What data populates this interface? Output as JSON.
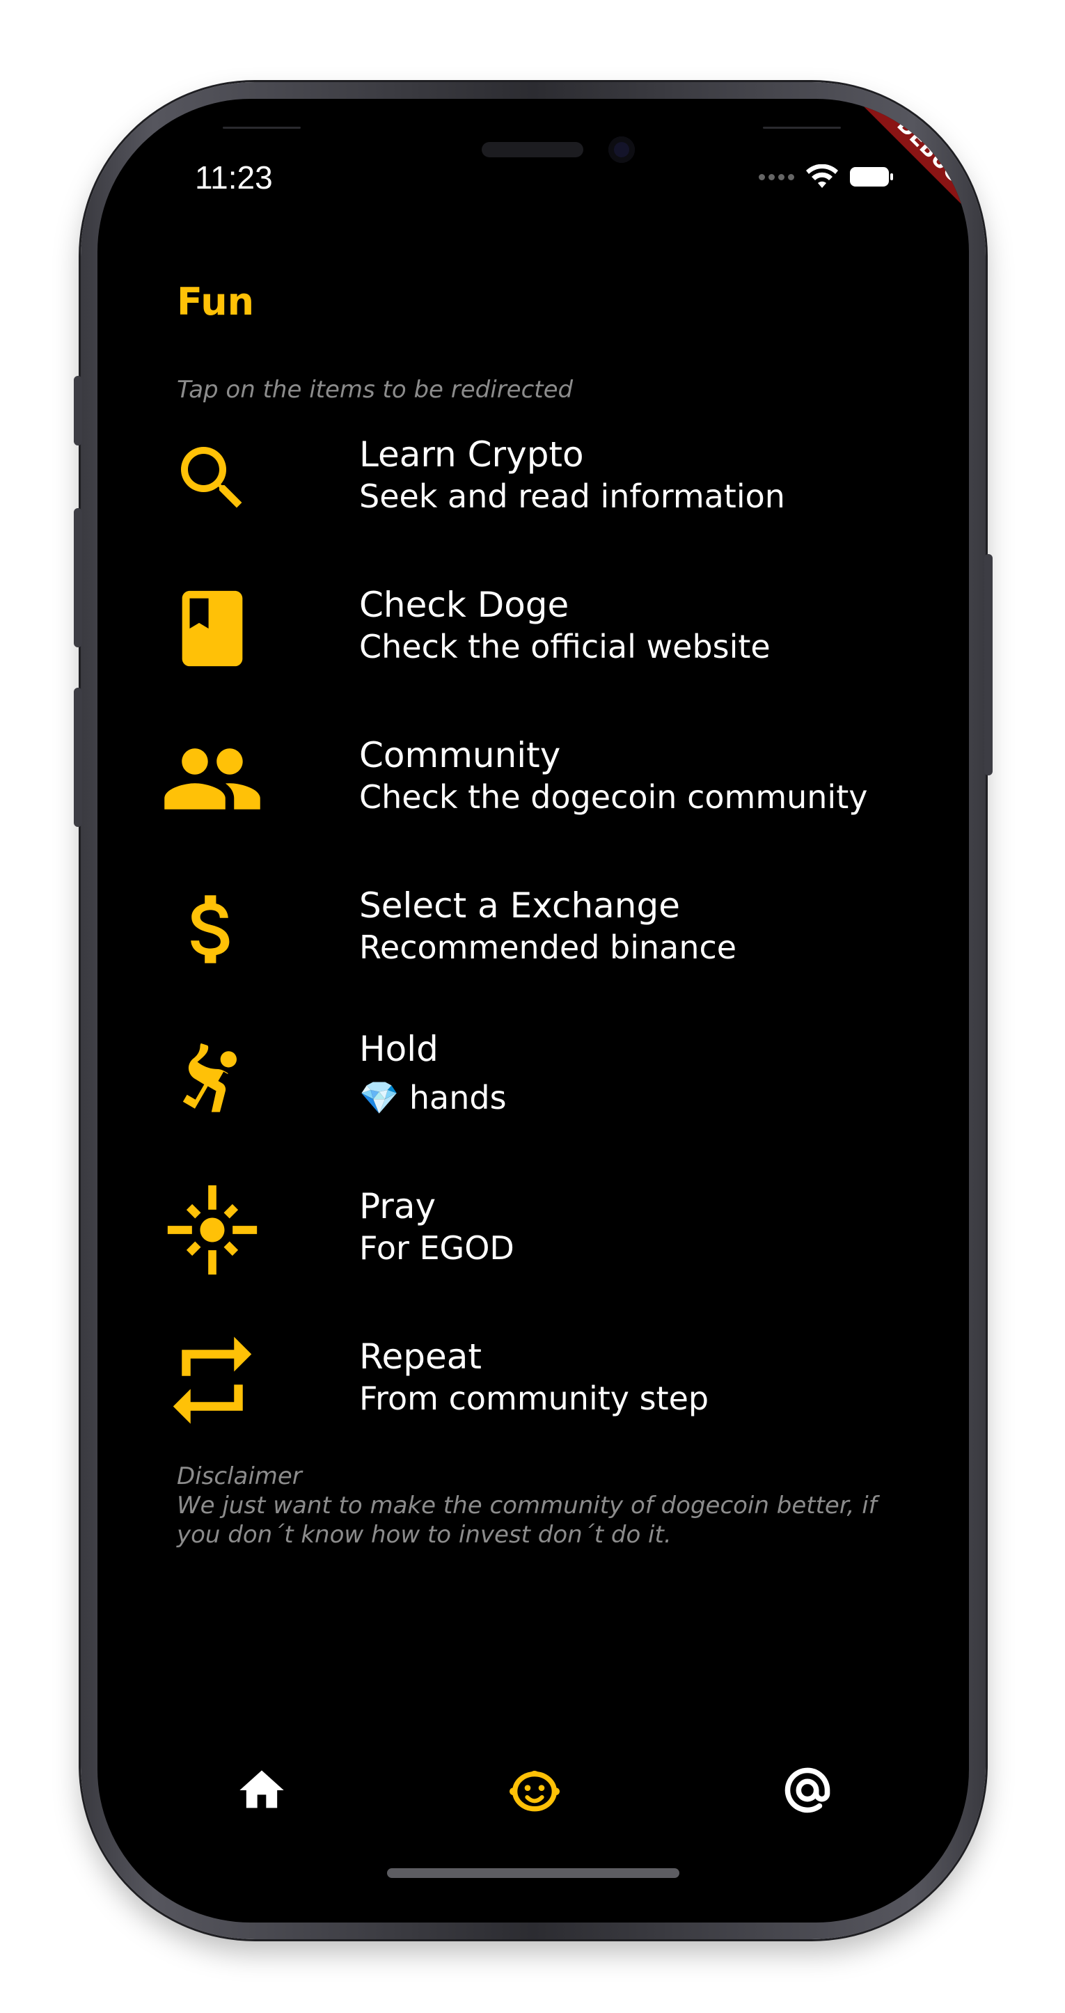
{
  "status_bar": {
    "time": "11:23"
  },
  "debug_banner": "DEBUG",
  "page": {
    "title": "Fun",
    "hint": "Tap on the items to be redirected"
  },
  "items": [
    {
      "title": "Learn Crypto",
      "subtitle": "Seek and read information",
      "icon": "search-icon"
    },
    {
      "title": "Check Doge",
      "subtitle": "Check the official website",
      "icon": "bookmark-book-icon"
    },
    {
      "title": "Community",
      "subtitle": "Check the dogecoin community",
      "icon": "people-icon"
    },
    {
      "title": "Select a Exchange",
      "subtitle": "Recommended binance",
      "icon": "dollar-icon"
    },
    {
      "title": "Hold",
      "subtitle": "💎 hands",
      "icon": "sports-handball-icon"
    },
    {
      "title": "Pray",
      "subtitle": "For EGOD",
      "icon": "flare-icon"
    },
    {
      "title": "Repeat",
      "subtitle": "From community step",
      "icon": "repeat-icon"
    }
  ],
  "disclaimer": {
    "heading": "Disclaimer",
    "text": "We just want to make the community of dogecoin better, if you don´t know how to invest don´t do it."
  },
  "bottom_nav": [
    {
      "icon": "home-icon",
      "active": false
    },
    {
      "icon": "child-face-icon",
      "active": true
    },
    {
      "icon": "at-sign-icon",
      "active": false
    }
  ],
  "colors": {
    "accent": "#FFC107",
    "background": "#000000",
    "text": "#FFFFFF",
    "muted": "#8C8C8C",
    "debug": "#8B1414"
  }
}
